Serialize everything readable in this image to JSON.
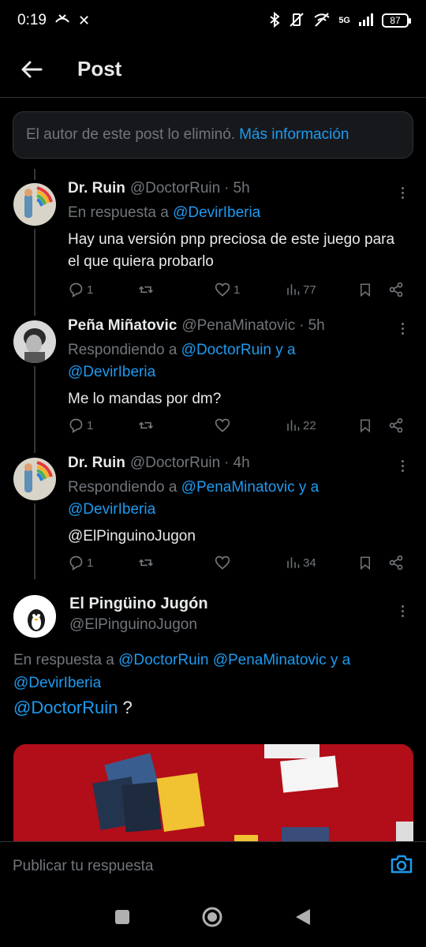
{
  "status_bar": {
    "time": "0:19",
    "network": "5G",
    "battery": "87"
  },
  "header": {
    "title": "Post"
  },
  "deleted_notice": {
    "text": "El autor de este post lo eliminó.",
    "link": "Más información"
  },
  "tweets": [
    {
      "name": "Dr. Ruin",
      "handle": "@DoctorRuin",
      "time": "5h",
      "reply_prefix": "En respuesta a",
      "reply_to": [
        "@DevirIberia"
      ],
      "text": "Hay una versión pnp preciosa de este juego para el que quiera probarlo",
      "replies": "1",
      "retweets": "",
      "likes": "1",
      "views": "77"
    },
    {
      "name": "Peña Miñatovic",
      "handle": "@PenaMinatovic",
      "time": "5h",
      "reply_prefix": "Respondiendo a",
      "reply_to": [
        "@DoctorRuin y a",
        "@DevirIberia"
      ],
      "text": "Me lo mandas por dm?",
      "replies": "1",
      "retweets": "",
      "likes": "",
      "views": "22"
    },
    {
      "name": "Dr. Ruin",
      "handle": "@DoctorRuin",
      "time": "4h",
      "reply_prefix": "Respondiendo a",
      "reply_to": [
        "@PenaMinatovic y a",
        "@DevirIberia"
      ],
      "text": "@ElPinguinoJugon",
      "replies": "1",
      "retweets": "",
      "likes": "",
      "views": "34"
    }
  ],
  "main_tweet": {
    "name": "El Pingüino Jugón",
    "handle": "@ElPinguinoJugon",
    "reply_prefix": "En respuesta a",
    "reply_to_line1": "@DoctorRuin @PenaMinatovic y a",
    "reply_to_line2": "@DevirIberia",
    "mention": "@DoctorRuin",
    "text_suffix": " ?"
  },
  "reply_bar": {
    "placeholder": "Publicar tu respuesta"
  },
  "colors": {
    "background": "#000000",
    "accent": "#1d9bf0",
    "muted": "#71767b",
    "text": "#e7e9ea"
  }
}
